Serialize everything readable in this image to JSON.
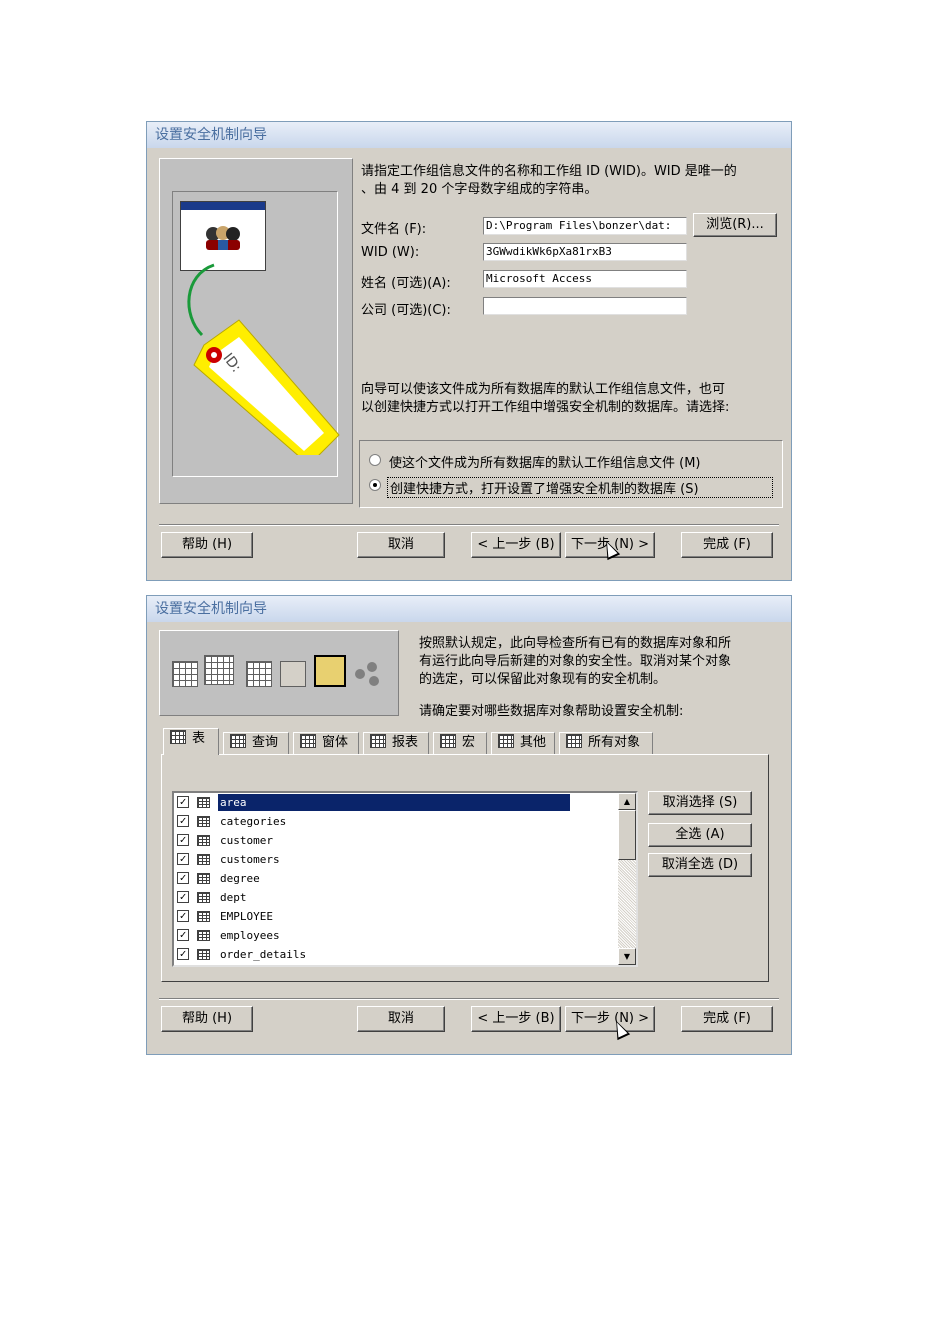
{
  "dialog1": {
    "title": "设置安全机制向导",
    "intro_line1": "请指定工作组信息文件的名称和工作组 ID (WID)。WID 是唯一的",
    "intro_line2": "、由 4 到 20 个字母数字组成的字符串。",
    "filename_label": "文件名 (F):",
    "filename_value": "D:\\Program Files\\bonzer\\dat:",
    "browse_button": "浏览(R)...",
    "wid_label": "WID (W):",
    "wid_value": "3GWwdikWk6pXa81rxB3",
    "name_label": "姓名 (可选)(A):",
    "name_value": "Microsoft Access",
    "company_label": "公司 (可选)(C):",
    "company_value": "",
    "desc_line1": "向导可以使该文件成为所有数据库的默认工作组信息文件，也可",
    "desc_line2": "以创建快捷方式以打开工作组中增强安全机制的数据库。请选择:",
    "option1": "使这个文件成为所有数据库的默认工作组信息文件 (M)",
    "option2": "创建快捷方式，打开设置了增强安全机制的数据库 (S)",
    "selected_option": "option2",
    "tag_text": "ID:",
    "buttons": {
      "help": "帮助 (H)",
      "cancel": "取消",
      "back": "< 上一步 (B)",
      "next": "下一步 (N) >",
      "finish": "完成 (F)"
    }
  },
  "dialog2": {
    "title": "设置安全机制向导",
    "intro_line1": "按照默认规定，此向导检查所有已有的数据库对象和所",
    "intro_line2": "有运行此向导后新建的对象的安全性。取消对某个对象",
    "intro_line3": "的选定，可以保留此对象现有的安全机制。",
    "question": "请确定要对哪些数据库对象帮助设置安全机制:",
    "tabs": [
      "表",
      "查询",
      "窗体",
      "报表",
      "宏",
      "其他",
      "所有对象"
    ],
    "active_tab": "表",
    "items": [
      {
        "name": "area",
        "checked": true,
        "selected": true
      },
      {
        "name": "categories",
        "checked": true,
        "selected": false
      },
      {
        "name": "customer",
        "checked": true,
        "selected": false
      },
      {
        "name": "customers",
        "checked": true,
        "selected": false
      },
      {
        "name": "degree",
        "checked": true,
        "selected": false
      },
      {
        "name": "dept",
        "checked": true,
        "selected": false
      },
      {
        "name": "EMPLOYEE",
        "checked": true,
        "selected": false
      },
      {
        "name": "employees",
        "checked": true,
        "selected": false
      },
      {
        "name": "order_details",
        "checked": true,
        "selected": false
      }
    ],
    "side_buttons": {
      "deselect": "取消选择 (S)",
      "select_all": "全选 (A)",
      "deselect_all": "取消全选 (D)"
    },
    "buttons": {
      "help": "帮助 (H)",
      "cancel": "取消",
      "back": "< 上一步 (B)",
      "next": "下一步 (N) >",
      "finish": "完成 (F)"
    }
  },
  "colors": {
    "dialog_bg": "#d4d0c8",
    "selection": "#0a246a",
    "title_text": "#4a6fa0",
    "tag_yellow": "#ffee00"
  }
}
